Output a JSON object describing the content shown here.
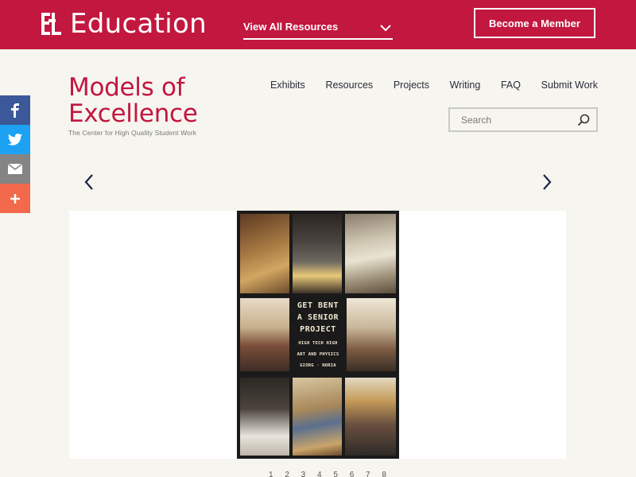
{
  "topbar": {
    "logo_text": "Education",
    "view_all_label": "View All Resources",
    "become_member_label": "Become a Member"
  },
  "social": {
    "facebook_icon": "facebook-icon",
    "twitter_icon": "twitter-icon",
    "email_icon": "email-icon",
    "share_icon": "plus-icon"
  },
  "brand": {
    "title_line1": "Models of",
    "title_line2": "Excellence",
    "subtitle": "The Center for High Quality Student Work"
  },
  "nav": {
    "items": [
      "Exhibits",
      "Resources",
      "Projects",
      "Writing",
      "FAQ",
      "Submit Work"
    ]
  },
  "search": {
    "placeholder": "Search"
  },
  "poster": {
    "title_line1": "GET BENT",
    "title_line2": "A SENIOR",
    "title_line3": "PROJECT",
    "sub_line1": "HIGH TECH HIGH",
    "sub_line2": "ART AND PHYSICS",
    "sub_line3": "GIORG · NORIA"
  },
  "pager": {
    "text": "1 2 3 4 5 6 7 8"
  },
  "colors": {
    "brand": "#c2173f",
    "background": "#f6f5ef",
    "facebook": "#3b5998",
    "twitter": "#1da1f2",
    "email": "#848484",
    "share": "#f2694b"
  }
}
